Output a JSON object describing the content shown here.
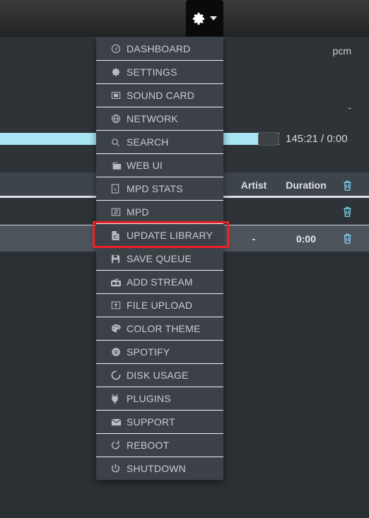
{
  "header": {
    "volume_icon": "volume-icon",
    "settings_icon": "gear-icon",
    "caret_icon": "caret-down-icon"
  },
  "player": {
    "output_format": "pcm",
    "track_title": "-",
    "time_display": "145:21 / 0:00",
    "seek_percent": 76,
    "seek_color": "#a8e5f2"
  },
  "queue": {
    "columns": {
      "artist": "Artist",
      "duration": "Duration",
      "delete_icon": "trash-icon"
    },
    "rows": [
      {
        "artist": "",
        "duration": "",
        "delete_icon": "trash-icon",
        "active": false
      },
      {
        "artist": "-",
        "duration": "0:00",
        "delete_icon": "trash-icon",
        "active": true
      }
    ]
  },
  "menu": {
    "items": [
      {
        "label": "DASHBOARD",
        "icon": "dashboard-icon"
      },
      {
        "label": "SETTINGS",
        "icon": "gear-icon"
      },
      {
        "label": "SOUND CARD",
        "icon": "soundcard-icon"
      },
      {
        "label": "NETWORK",
        "icon": "globe-icon"
      },
      {
        "label": "SEARCH",
        "icon": "search-icon"
      },
      {
        "label": "WEB UI",
        "icon": "images-icon"
      },
      {
        "label": "MPD STATS",
        "icon": "info-icon"
      },
      {
        "label": "MPD",
        "icon": "music-note-icon"
      },
      {
        "label": "UPDATE LIBRARY",
        "icon": "refresh-file-icon"
      },
      {
        "label": "SAVE QUEUE",
        "icon": "floppy-icon"
      },
      {
        "label": "ADD STREAM",
        "icon": "radio-icon"
      },
      {
        "label": "FILE UPLOAD",
        "icon": "upload-icon"
      },
      {
        "label": "COLOR THEME",
        "icon": "palette-icon"
      },
      {
        "label": "SPOTIFY",
        "icon": "spotify-icon"
      },
      {
        "label": "DISK USAGE",
        "icon": "disk-icon"
      },
      {
        "label": "PLUGINS",
        "icon": "plug-icon"
      },
      {
        "label": "SUPPORT",
        "icon": "envelope-icon"
      },
      {
        "label": "REBOOT",
        "icon": "reboot-icon"
      },
      {
        "label": "SHUTDOWN",
        "icon": "power-icon"
      }
    ]
  },
  "annotation": {
    "highlight_target": "UPDATE LIBRARY",
    "highlight_color": "#ee2025"
  }
}
